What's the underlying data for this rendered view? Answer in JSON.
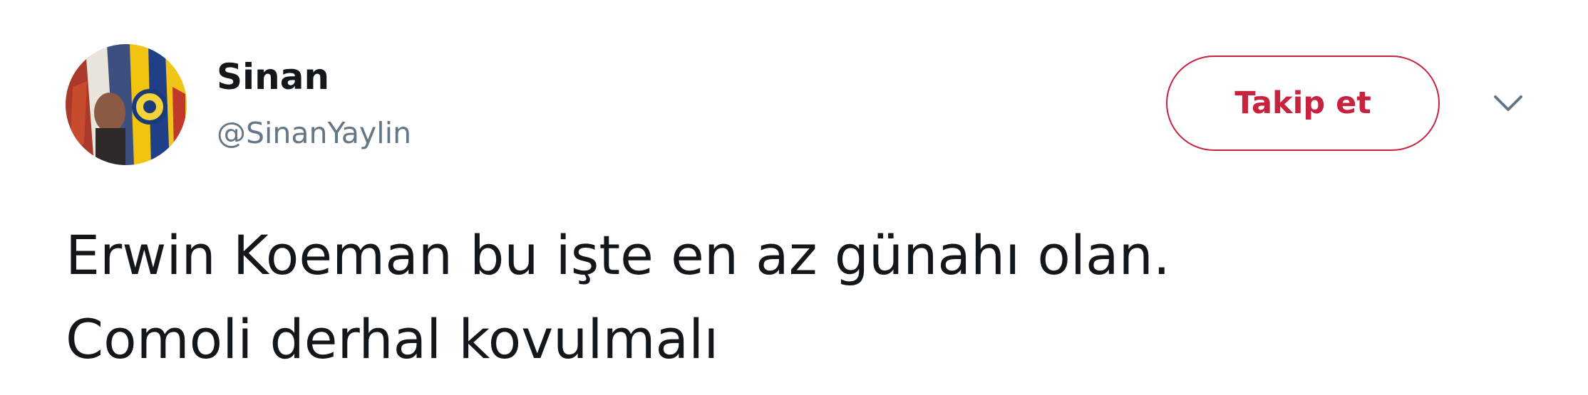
{
  "tweet": {
    "author": {
      "display_name": "Sinan",
      "handle": "@SinanYaylin"
    },
    "follow_label": "Takip et",
    "text_lines": [
      "Erwin Koeman bu işte en az günahı olan.",
      "Comoli derhal kovulmalı"
    ]
  },
  "icons": {
    "avatar": "avatar-image",
    "more": "chevron-down-icon"
  },
  "colors": {
    "follow_accent": "#c8233e",
    "name_text": "#14171a",
    "handle_text": "#657786",
    "caret": "#657786"
  }
}
